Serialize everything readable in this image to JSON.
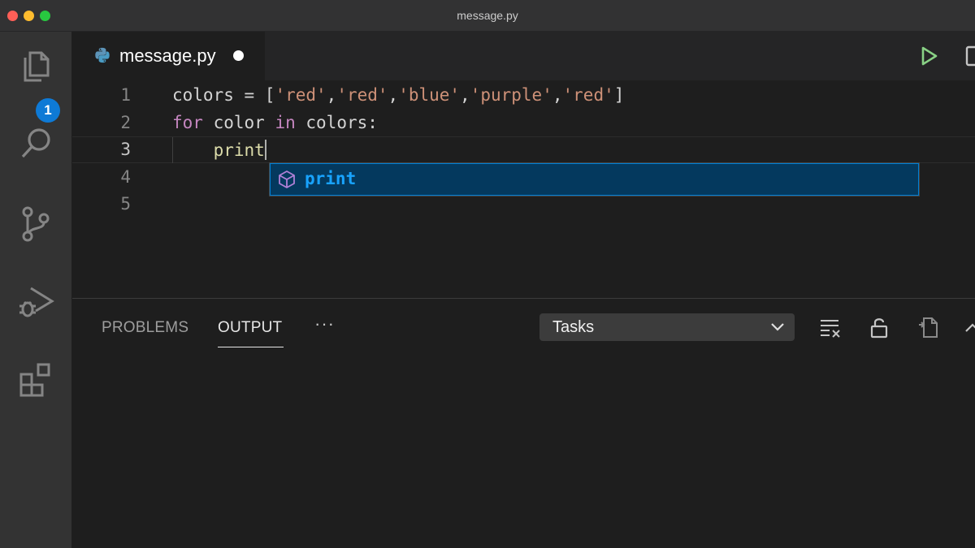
{
  "window": {
    "title": "message.py"
  },
  "activity_bar": {
    "explorer_badge": "1",
    "items": [
      "explorer-icon",
      "search-icon",
      "source-control-icon",
      "run-debug-icon",
      "extensions-icon"
    ]
  },
  "tabs": [
    {
      "label": "message.py",
      "icon": "python-icon",
      "dirty": true
    }
  ],
  "editor": {
    "line_numbers": [
      "1",
      "2",
      "3",
      "4",
      "5"
    ],
    "active_line": "3",
    "lines": [
      {
        "tokens": [
          {
            "text": "colors = [",
            "type": "var"
          },
          {
            "text": "'red'",
            "type": "str"
          },
          {
            "text": ",",
            "type": "var"
          },
          {
            "text": "'red'",
            "type": "str"
          },
          {
            "text": ",",
            "type": "var"
          },
          {
            "text": "'blue'",
            "type": "str"
          },
          {
            "text": ",",
            "type": "var"
          },
          {
            "text": "'purple'",
            "type": "str"
          },
          {
            "text": ",",
            "type": "var"
          },
          {
            "text": "'red'",
            "type": "str"
          },
          {
            "text": "]",
            "type": "var"
          }
        ]
      },
      {
        "tokens": [
          {
            "text": "for",
            "type": "kw"
          },
          {
            "text": " color ",
            "type": "var"
          },
          {
            "text": "in",
            "type": "kw"
          },
          {
            "text": " colors:",
            "type": "var"
          }
        ]
      },
      {
        "tokens": [
          {
            "text": "    print",
            "type": "fn"
          }
        ]
      }
    ],
    "suggestion": {
      "label": "print",
      "icon": "symbol-method-icon"
    }
  },
  "panel": {
    "tabs": [
      "PROBLEMS",
      "OUTPUT"
    ],
    "active_tab": "OUTPUT",
    "more": "···",
    "output_channel": "Tasks"
  },
  "colors": {
    "keyword": "#c586c0",
    "string": "#ce9178",
    "function": "#dcdcaa",
    "accent": "#0e7ad6",
    "run": "#89d185"
  }
}
